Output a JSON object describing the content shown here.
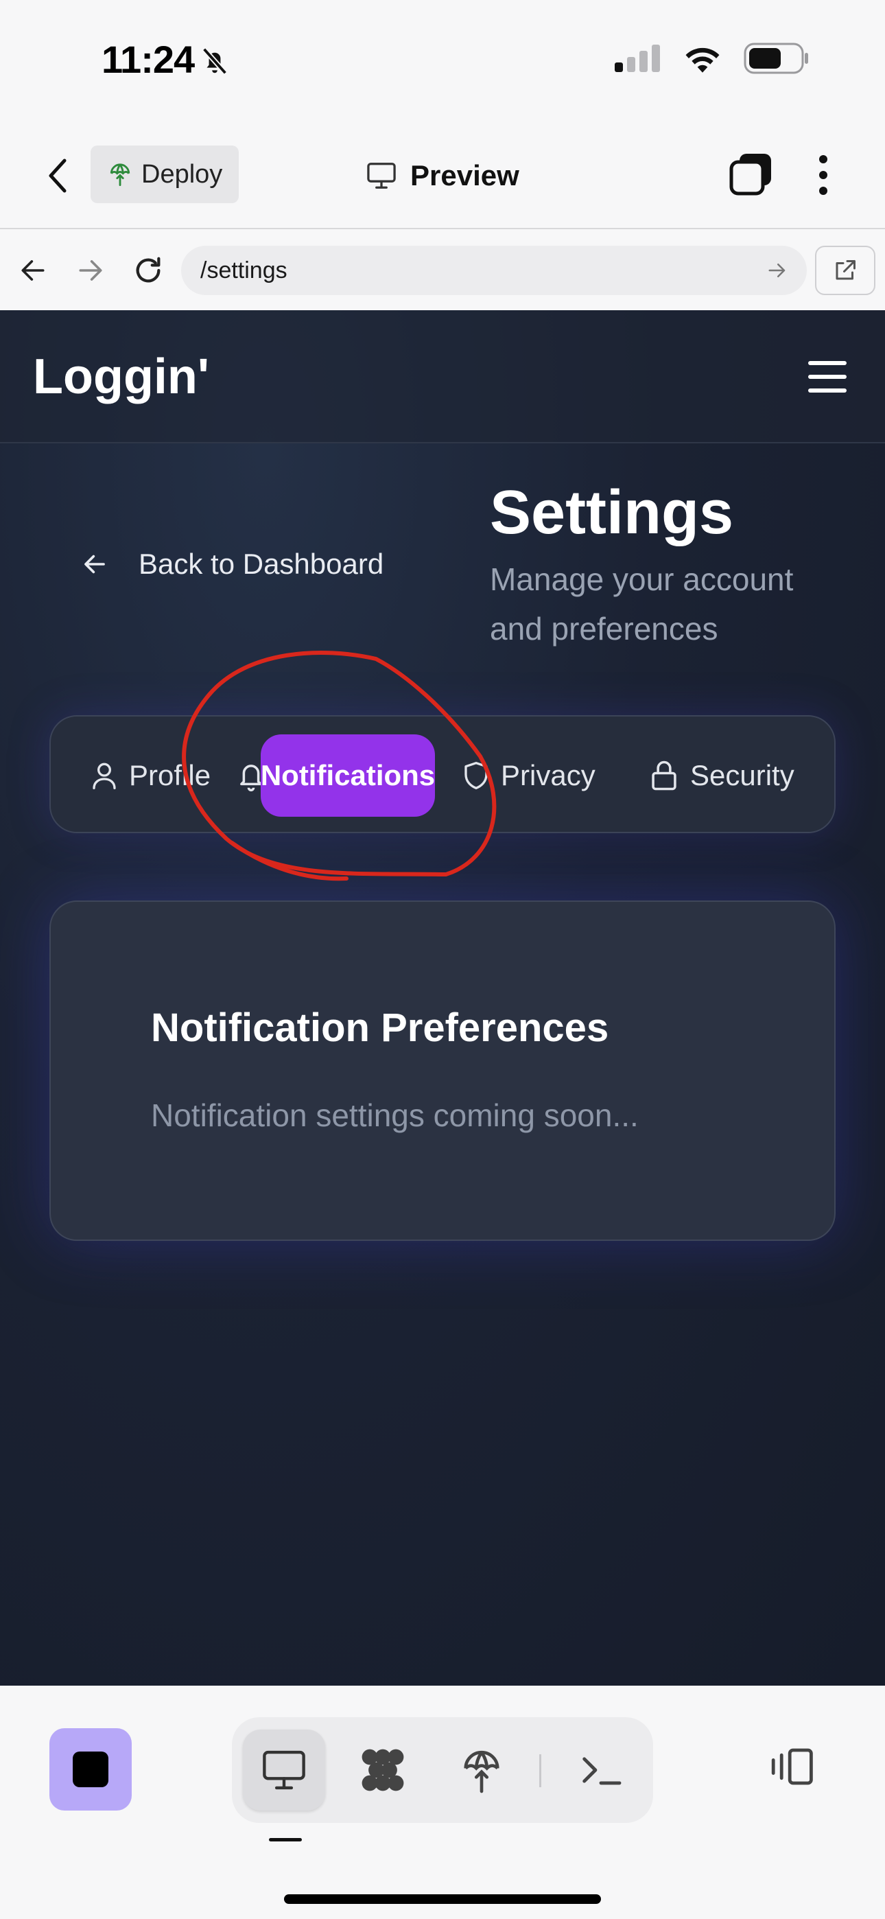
{
  "status_bar": {
    "time": "11:24",
    "icons": [
      "bell-slash-icon",
      "cellular-signal-icon",
      "wifi-icon",
      "battery-icon"
    ]
  },
  "app_header": {
    "deploy_label": "Deploy",
    "preview_label": "Preview"
  },
  "browser": {
    "url": "/settings"
  },
  "site": {
    "logo": "Loggin'",
    "back_label": "Back to Dashboard",
    "title": "Settings",
    "subtitle": "Manage your account and preferences",
    "tabs": [
      {
        "label": "Profile",
        "icon": "user-icon",
        "active": false
      },
      {
        "label": "Notifications",
        "icon": "bell-icon",
        "active": true
      },
      {
        "label": "Privacy",
        "icon": "shield-icon",
        "active": false
      },
      {
        "label": "Security",
        "icon": "lock-icon",
        "active": false
      }
    ],
    "card": {
      "title": "Notification Preferences",
      "text": "Notification settings coming soon..."
    }
  },
  "colors": {
    "accent": "#9333ea",
    "annotation": "#d9271c",
    "page_bg": "#1b2233"
  },
  "bottom_bar": {
    "modes": [
      "desktop-icon",
      "workflow-icon",
      "deploy-icon",
      "terminal-icon"
    ],
    "active_mode": "desktop-icon"
  }
}
